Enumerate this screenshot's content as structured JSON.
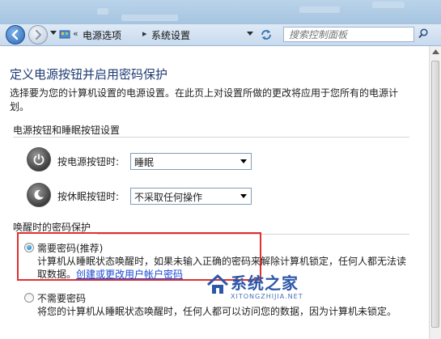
{
  "address_bar": {
    "breadcrumb": [
      "电源选项",
      "系统设置"
    ],
    "search_placeholder": "搜索控制面板"
  },
  "page": {
    "title": "定义电源按钮并启用密码保护",
    "description": "选择要为您的计算机设置的电源设置。在此页上对设置所做的更改将应用于您所有的电源计划。"
  },
  "buttons_section": {
    "heading": "电源按钮和睡眠按钮设置",
    "power_button": {
      "label": "按电源按钮时:",
      "value": "睡眠"
    },
    "sleep_button": {
      "label": "按休眠按钮时:",
      "value": "不采取任何操作"
    }
  },
  "wakeup_section": {
    "heading": "唤醒时的密码保护",
    "option_require": {
      "label": "需要密码(推荐)",
      "description": "计算机从睡眠状态唤醒时，如果未输入正确的密码来解除计算机锁定，任何人都无法读取数据。",
      "link": "创建或更改用户帐户密码",
      "selected": true
    },
    "option_no_password": {
      "label": "不需要密码",
      "description": "将您的计算机从睡眠状态唤醒时，任何人都可以访问您的数据，因为计算机未锁定。",
      "selected": false
    }
  },
  "watermark": {
    "brand": "系统之家",
    "domain": "XITONGZHIJIA.NET"
  },
  "colors": {
    "title": "#1f3b72",
    "link": "#1a4bd3",
    "highlight": "#e03030"
  }
}
